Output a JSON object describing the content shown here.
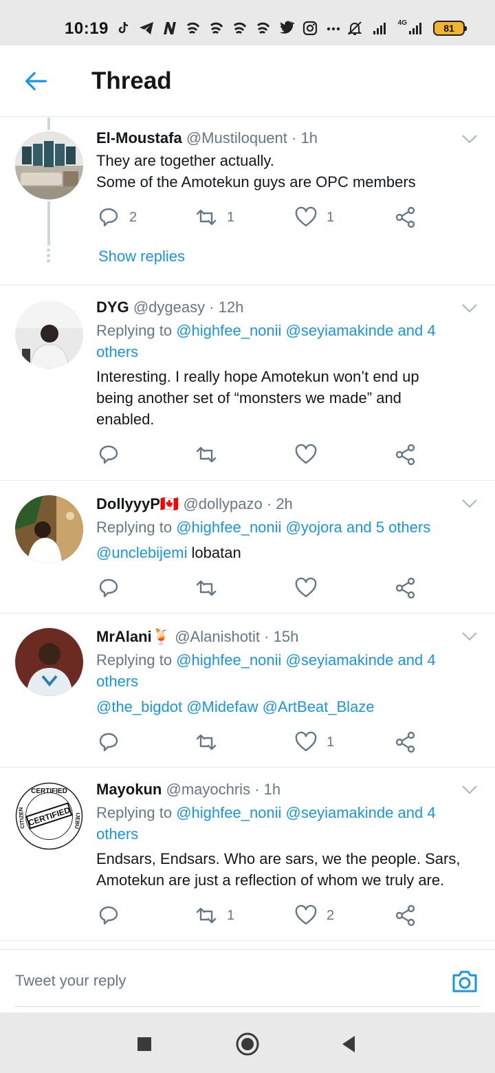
{
  "status_bar": {
    "time": "10:19",
    "network": "4G",
    "battery": "81",
    "icons": [
      "tiktok-icon",
      "telegram-icon",
      "n-app-icon",
      "swirl-icon",
      "swirl-icon",
      "swirl-icon",
      "swirl-icon",
      "twitter-icon",
      "instagram-icon",
      "more-dots-icon",
      "mute-icon",
      "signal-icon",
      "signal-4g-icon",
      "battery-icon"
    ]
  },
  "header": {
    "title": "Thread"
  },
  "tweets": [
    {
      "name": "El-Moustafa",
      "handle": "@Mustiloquent",
      "time": "· 1h",
      "text1": "They are together actually.",
      "text2": "Some of the Amotekun guys are OPC members",
      "replies": "2",
      "retweets": "1",
      "likes": "1",
      "show_replies": "Show replies"
    },
    {
      "name": "DYG",
      "handle": "@dygeasy",
      "time": "· 12h",
      "replying_prefix": "Replying to",
      "replying_users": "@highfee_nonii @seyiamakinde and 4 others",
      "text": "Interesting. I really hope Amotekun won’t end up being another set of “monsters we made” and enabled."
    },
    {
      "name": "DollyyyP🇨🇦",
      "handle": "@dollypazo",
      "time": "· 2h",
      "replying_prefix": "Replying to",
      "replying_users": "@highfee_nonii @yojora and 5 others",
      "mention": "@unclebijemi",
      "text": " lobatan"
    },
    {
      "name": "MrAlani🍹",
      "handle": "@Alanishotit",
      "time": "· 15h",
      "replying_prefix": "Replying to",
      "replying_users": "@highfee_nonii @seyiamakinde and 4 others",
      "mentions": "@the_bigdot @Midefaw @ArtBeat_Blaze",
      "likes": "1"
    },
    {
      "name": "Mayokun",
      "handle": "@mayochris",
      "time": "· 1h",
      "replying_prefix": "Replying to",
      "replying_users": "@highfee_nonii @seyiamakinde and 4 others",
      "text": "Endsars, Endsars. Who are sars, we the people. Sars, Amotekun are just a reflection of whom we truly are.",
      "retweets": "1",
      "likes": "2",
      "avatar_text_top": "CERTIFIED",
      "avatar_text_mid": "CERTIFIED",
      "avatar_text_left": "CITIZEN",
      "avatar_text_right": "IJEBU"
    }
  ],
  "compose": {
    "placeholder": "Tweet your reply"
  },
  "colors": {
    "accent": "#1b95e0",
    "text": "#14171a",
    "muted": "#657786",
    "divider": "#e1e8ed"
  }
}
